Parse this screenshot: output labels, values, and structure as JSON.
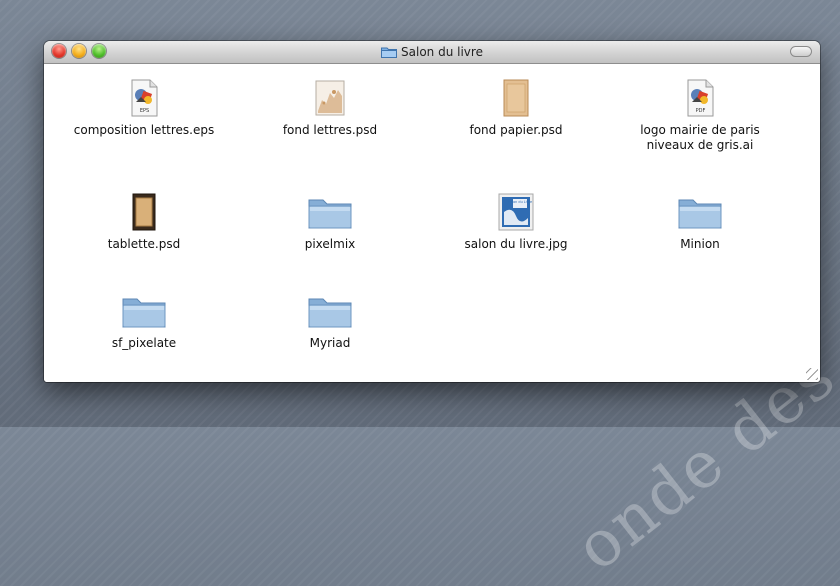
{
  "window": {
    "title": "Salon du livre"
  },
  "items": [
    {
      "label": "composition lettres.eps",
      "icon": "eps-document-icon",
      "badge": "EPS"
    },
    {
      "label": "fond lettres.psd",
      "icon": "psd-image-icon"
    },
    {
      "label": "fond papier.psd",
      "icon": "psd-paper-icon"
    },
    {
      "label": "logo mairie de paris\nniveaux de gris.ai",
      "icon": "pdf-document-icon",
      "badge": "PDF"
    },
    {
      "label": "tablette.psd",
      "icon": "psd-frame-icon"
    },
    {
      "label": "pixelmix",
      "icon": "folder-icon"
    },
    {
      "label": "salon du livre.jpg",
      "icon": "jpg-image-icon",
      "badge": "Salon du Livre"
    },
    {
      "label": "Minion",
      "icon": "folder-icon"
    },
    {
      "label": "sf_pixelate",
      "icon": "folder-icon"
    },
    {
      "label": "Myriad",
      "icon": "folder-icon"
    }
  ]
}
